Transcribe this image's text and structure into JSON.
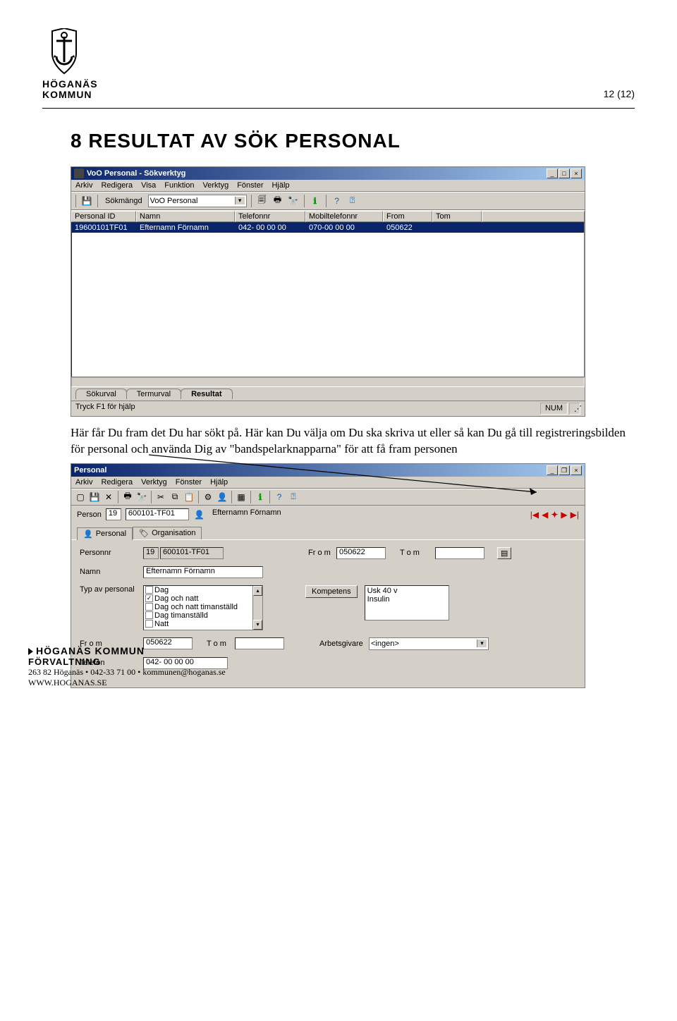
{
  "pageNumber": "12 (12)",
  "logo": {
    "line1": "HÖGANÄS",
    "line2": "KOMMUN"
  },
  "heading": "8  RESULTAT AV SÖK PERSONAL",
  "win1": {
    "title": "VoO Personal - Sökverktyg",
    "menu": [
      "Arkiv",
      "Redigera",
      "Visa",
      "Funktion",
      "Verktyg",
      "Fönster",
      "Hjälp"
    ],
    "toolbar": {
      "sokmangd_label": "Sökmängd",
      "combo_value": "VoO Personal"
    },
    "columns": [
      "Personal ID",
      "Namn",
      "Telefonnr",
      "Mobiltelefonnr",
      "From",
      "Tom"
    ],
    "row": {
      "id": "19600101TF01",
      "namn": "Efternamn Förnamn",
      "tel": "042- 00 00 00",
      "mobil": "070-00 00 00",
      "from": "050622",
      "tom": ""
    },
    "tabs": [
      "Sökurval",
      "Termurval",
      "Resultat"
    ],
    "status_left": "Tryck F1 för hjälp",
    "status_right": "NUM"
  },
  "para1": "Här får Du fram det Du har sökt på. Här kan Du välja om Du ska skriva ut eller så kan Du gå till registreringsbilden för personal och använda Dig av \"bandspelarknapparna\" för att få fram personen",
  "win2": {
    "title": "Personal",
    "menu": [
      "Arkiv",
      "Redigera",
      "Verktyg",
      "Fönster",
      "Hjälp"
    ],
    "person_label": "Person",
    "person_cc": "19",
    "person_num": "600101-TF01",
    "person_name": "Efternamn Förnamn",
    "tabs": [
      "Personal",
      "Organisation"
    ],
    "labels": {
      "personnr": "Personnr",
      "namn": "Namn",
      "typ": "Typ av personal",
      "from_outer": "Fr o m",
      "telefon": "Telefon",
      "from": "Fr o m",
      "tom": "T o m",
      "kompetens": "Kompetens",
      "arbetsgivare": "Arbetsgivare",
      "tom2": "T o m"
    },
    "values": {
      "personnr_cc": "19",
      "personnr_num": "600101-TF01",
      "namn": "Efternamn Förnamn",
      "from": "050622",
      "from_outer": "050622",
      "tom": "",
      "telefon": "042- 00 00 00",
      "arbetsgivare": "<ingen>"
    },
    "typ_list": [
      "Dag",
      "Dag och natt",
      "Dag och natt timanställd",
      "Dag timanställd",
      "Natt"
    ],
    "typ_checked_index": 1,
    "kompetens_list": [
      "Usk 40 v",
      "Insulin"
    ]
  },
  "footer": {
    "line1": "HÖGANÄS KOMMUN",
    "line2": "FÖRVALTNING",
    "line3": "263 82 Höganäs • 042-33 71 00 • kommunen@hoganas.se",
    "line4": "WWW.HOGANAS.SE"
  }
}
